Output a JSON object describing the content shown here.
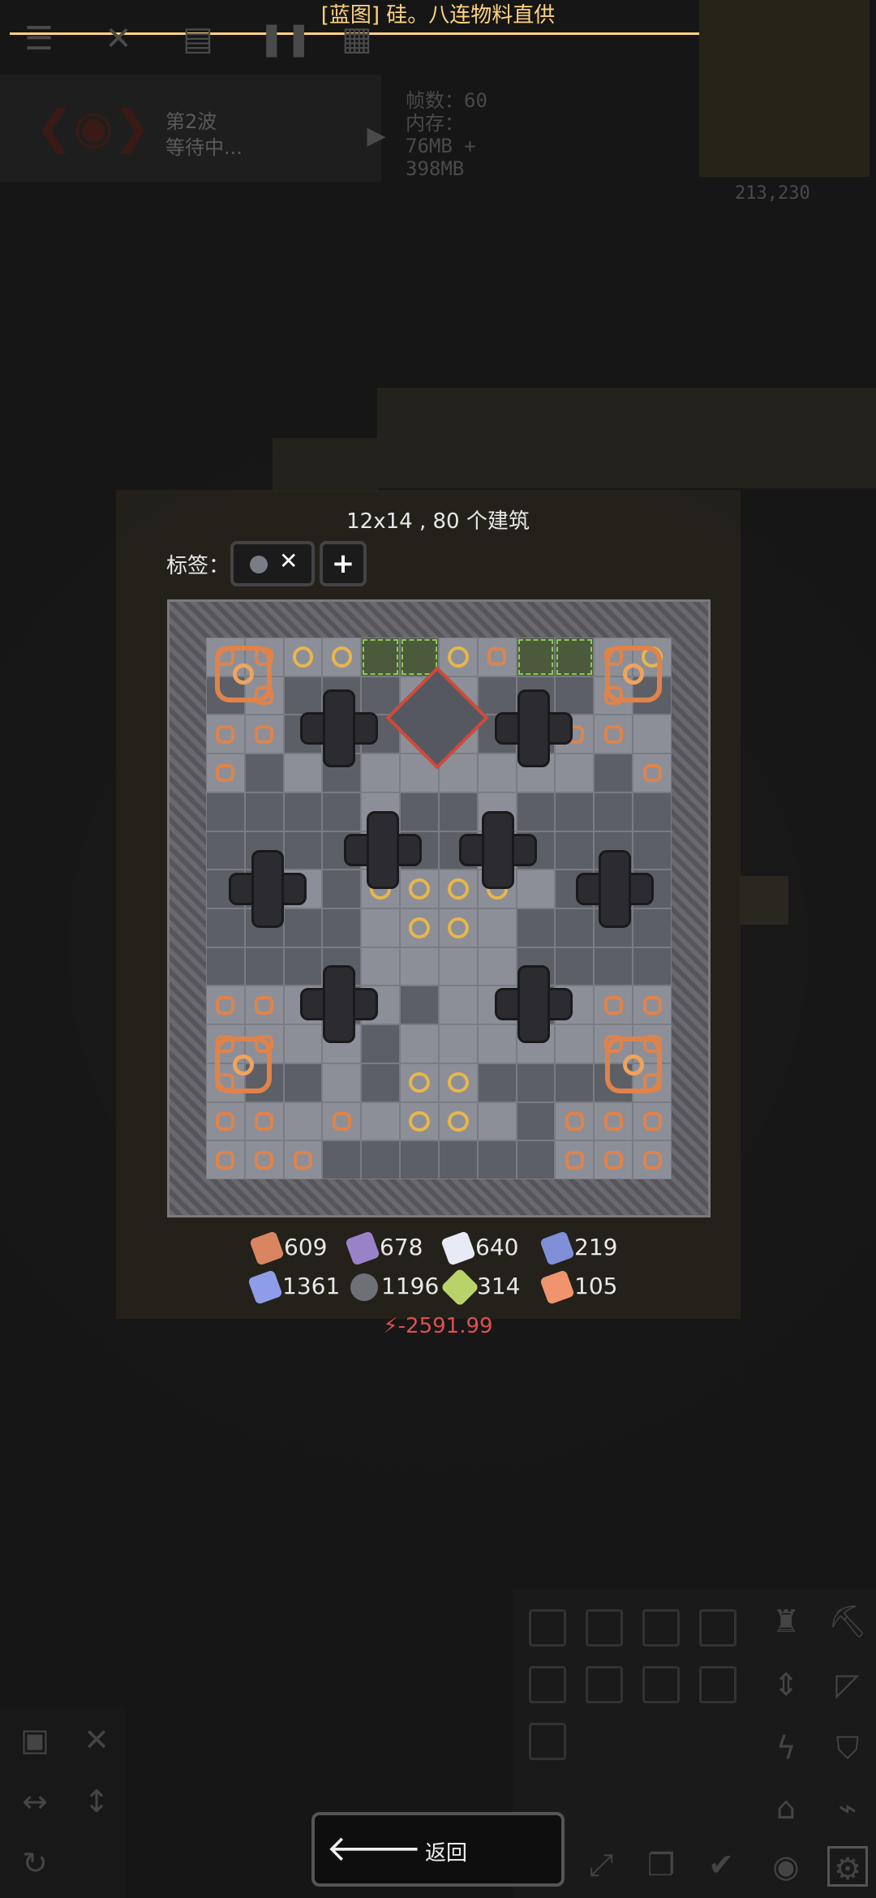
{
  "header": {
    "title": "[蓝图] 硅。八连物料直供"
  },
  "wave": {
    "label": "第2波",
    "status": "等待中..."
  },
  "stats": {
    "fps": "帧数：60",
    "memory_label": "内存：",
    "memory_value": "76MB +",
    "memory_extra": "398MB"
  },
  "coords": "213,230",
  "blueprint": {
    "size_text": "12x14 , 80 个建筑",
    "tags_label": "标签：",
    "tag_remove": "✕",
    "tag_add": "+"
  },
  "resources": [
    {
      "name": "copper",
      "amount": "609",
      "color": "#d98560"
    },
    {
      "name": "lead",
      "amount": "678",
      "color": "#9a82c8"
    },
    {
      "name": "metaglass",
      "amount": "640",
      "color": "#e8eaf6"
    },
    {
      "name": "titanium",
      "amount": "219",
      "color": "#7f8fd8"
    },
    {
      "name": "plastanium",
      "amount": "1361",
      "color": "#8f9ce8"
    },
    {
      "name": "silicon",
      "amount": "1196",
      "color": "#6e7078"
    },
    {
      "name": "surge",
      "amount": "314",
      "color": "#b9d36a"
    },
    {
      "name": "pyratite",
      "amount": "105",
      "color": "#f0946e"
    }
  ],
  "power": "⚡-2591.99",
  "back_button": {
    "label": "返回",
    "arrow": "🡐"
  },
  "colors": {
    "accent": "#ffd37f",
    "negative": "#e05050"
  }
}
